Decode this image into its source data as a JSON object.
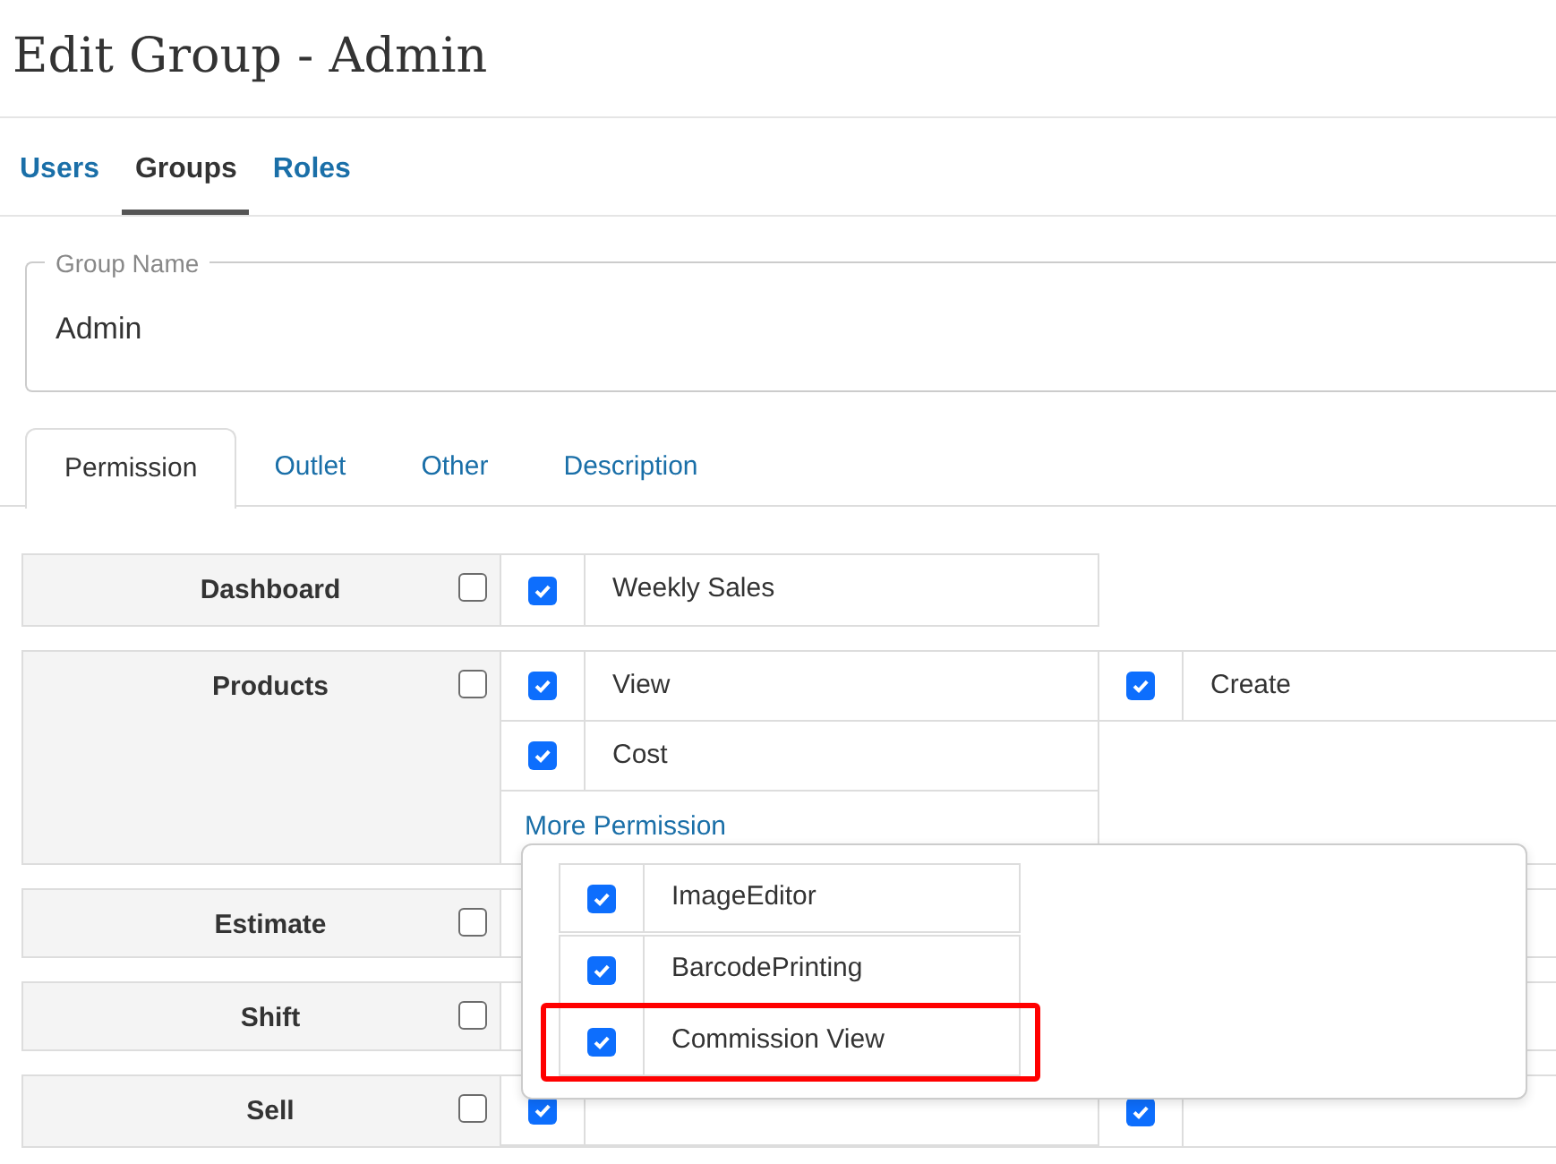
{
  "title": "Edit Group - Admin",
  "nav_tabs": [
    {
      "label": "Users",
      "selected": false
    },
    {
      "label": "Groups",
      "selected": true
    },
    {
      "label": "Roles",
      "selected": false
    }
  ],
  "group_name": {
    "label": "Group Name",
    "value": "Admin"
  },
  "tabs": [
    {
      "label": "Permission",
      "selected": true
    },
    {
      "label": "Outlet",
      "selected": false
    },
    {
      "label": "Other",
      "selected": false
    },
    {
      "label": "Description",
      "selected": false
    }
  ],
  "modules": [
    {
      "name": "Dashboard",
      "checked": false,
      "permissions": [
        {
          "label": "Weekly Sales",
          "checked": true
        }
      ]
    },
    {
      "name": "Products",
      "checked": false,
      "permissions": [
        {
          "label": "View",
          "checked": true
        },
        {
          "label": "Create",
          "checked": true
        },
        {
          "label": "Cost",
          "checked": true
        }
      ],
      "more_link": "More Permission"
    },
    {
      "name": "Estimate",
      "checked": false
    },
    {
      "name": "Shift",
      "checked": false
    },
    {
      "name": "Sell",
      "checked": false,
      "permissions": [
        {
          "checked": true
        },
        {
          "checked": true
        }
      ]
    }
  ],
  "more_permission_popup": {
    "items": [
      {
        "label": "ImageEditor",
        "checked": true,
        "highlighted": false
      },
      {
        "label": "BarcodePrinting",
        "checked": true,
        "highlighted": false
      },
      {
        "label": "Commission View",
        "checked": true,
        "highlighted": true
      }
    ]
  }
}
